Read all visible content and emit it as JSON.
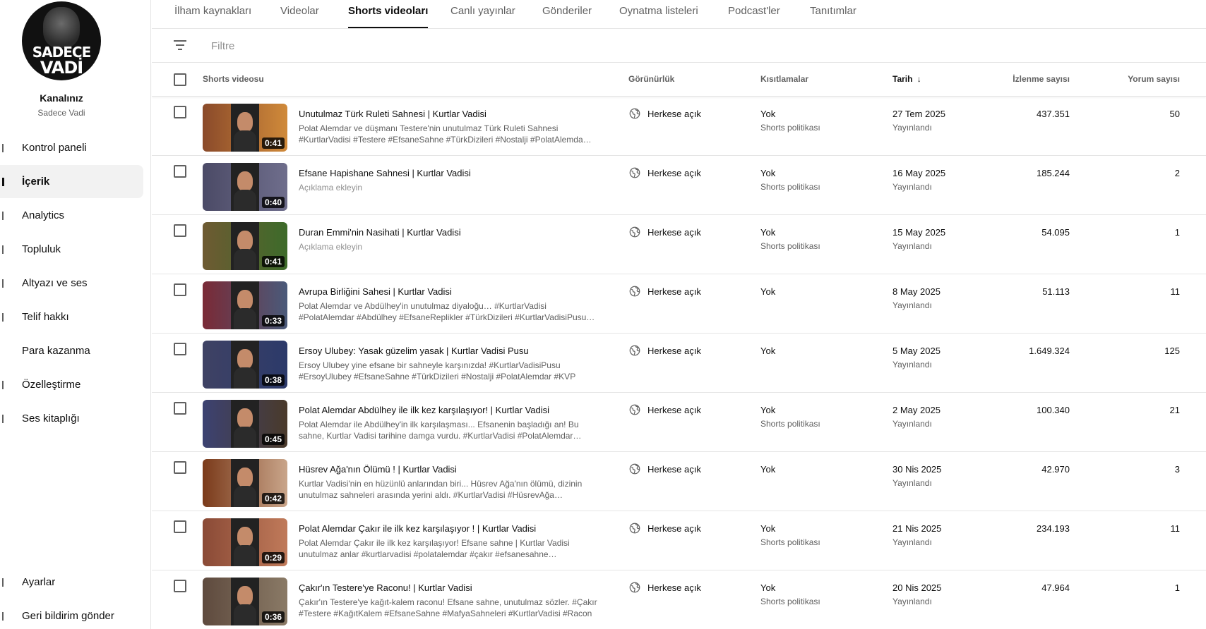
{
  "sidebar": {
    "avatar_text_top": "SADECE",
    "avatar_text_bottom": "VADİ",
    "channel_label": "Kanalınız",
    "channel_name": "Sadece Vadi",
    "items": [
      {
        "label": "Kontrol paneli",
        "icon": "dashboard-icon"
      },
      {
        "label": "İçerik",
        "icon": "content-icon",
        "active": true
      },
      {
        "label": "Analytics",
        "icon": "analytics-icon"
      },
      {
        "label": "Topluluk",
        "icon": "community-icon"
      },
      {
        "label": "Altyazı ve ses",
        "icon": "subtitles-icon"
      },
      {
        "label": "Telif hakkı",
        "icon": "copyright-icon"
      },
      {
        "label": "Para kazanma",
        "icon": "monetization-icon"
      },
      {
        "label": "Özelleştirme",
        "icon": "customization-icon"
      },
      {
        "label": "Ses kitaplığı",
        "icon": "audio-library-icon"
      }
    ],
    "bottom_items": [
      {
        "label": "Ayarlar",
        "icon": "settings-icon"
      },
      {
        "label": "Geri bildirim gönder",
        "icon": "feedback-icon"
      }
    ]
  },
  "tabs": [
    "İlham kaynakları",
    "Videolar",
    "Shorts videoları",
    "Canlı yayınlar",
    "Gönderiler",
    "Oynatma listeleri",
    "Podcast'ler",
    "Tanıtımlar"
  ],
  "active_tab": "Shorts videoları",
  "filter": {
    "placeholder": "Filtre",
    "icon": "filter-icon"
  },
  "columns": {
    "video": "Shorts videosu",
    "visibility": "Görünürlük",
    "restrictions": "Kısıtlamalar",
    "date": "Tarih",
    "date_sort": "↓",
    "views": "İzlenme sayısı",
    "comments": "Yorum sayısı"
  },
  "rows": [
    {
      "title": "Unutulmaz Türk Ruleti Sahnesi | Kurtlar Vadisi",
      "desc": "Polat Alemdar ve düşmanı Testere'nin unutulmaz Türk Ruleti Sahnesi #KurtlarVadisi #Testere #EfsaneSahne #TürkDizileri #Nostalji #PolatAlemda…",
      "desc_placeholder": false,
      "duration": "0:41",
      "visibility": "Herkese açık",
      "restriction": "Yok",
      "restriction_sub": "Shorts politikası",
      "date": "27 Tem 2025",
      "date_status": "Yayınlandı",
      "views": "437.351",
      "comments": "50",
      "thumb_bg": "#8a4a2a",
      "thumb_accent": "#d08a3a"
    },
    {
      "title": "Efsane Hapishane Sahnesi | Kurtlar Vadisi",
      "desc": "Açıklama ekleyin",
      "desc_placeholder": true,
      "duration": "0:40",
      "visibility": "Herkese açık",
      "restriction": "Yok",
      "restriction_sub": "Shorts politikası",
      "date": "16 May 2025",
      "date_status": "Yayınlandı",
      "views": "185.244",
      "comments": "2",
      "thumb_bg": "#4b4a66",
      "thumb_accent": "#6f6e8c"
    },
    {
      "title": "Duran Emmi'nin Nasihati | Kurtlar Vadisi",
      "desc": "Açıklama ekleyin",
      "desc_placeholder": true,
      "duration": "0:41",
      "visibility": "Herkese açık",
      "restriction": "Yok",
      "restriction_sub": "Shorts politikası",
      "date": "15 May 2025",
      "date_status": "Yayınlandı",
      "views": "54.095",
      "comments": "1",
      "thumb_bg": "#6e5a32",
      "thumb_accent": "#3d6b2a"
    },
    {
      "title": "Avrupa Birliğini Sahesi | Kurtlar Vadisi",
      "desc": "Polat Alemdar ve Abdülhey'in unutulmaz diyaloğu… #KurtlarVadisi #PolatAlemdar #Abdülhey #EfsaneReplikler #TürkDizileri #KurtlarVadisiPusu…",
      "desc_placeholder": false,
      "duration": "0:33",
      "visibility": "Herkese açık",
      "restriction": "Yok",
      "restriction_sub": "",
      "date": "8 May 2025",
      "date_status": "Yayınlandı",
      "views": "51.113",
      "comments": "11",
      "thumb_bg": "#7a2a36",
      "thumb_accent": "#4a5a7a"
    },
    {
      "title": "Ersoy Ulubey: Yasak güzelim yasak | Kurtlar Vadisi Pusu",
      "desc": "Ersoy Ulubey yine efsane bir sahneyle karşınızda! #KurtlarVadisiPusu #ErsoyUlubey #EfsaneSahne #TürkDizileri #Nostalji #PolatAlemdar #KVP",
      "desc_placeholder": false,
      "duration": "0:38",
      "visibility": "Herkese açık",
      "restriction": "Yok",
      "restriction_sub": "",
      "date": "5 May 2025",
      "date_status": "Yayınlandı",
      "views": "1.649.324",
      "comments": "125",
      "thumb_bg": "#3f4264",
      "thumb_accent": "#2c3a6a"
    },
    {
      "title": "Polat Alemdar Abdülhey ile ilk kez karşılaşıyor! | Kurtlar Vadisi",
      "desc": "Polat Alemdar ile Abdülhey'in ilk karşılaşması... Efsanenin başladığı an! Bu sahne, Kurtlar Vadisi tarihine damga vurdu. #KurtlarVadisi #PolatAlemdar…",
      "desc_placeholder": false,
      "duration": "0:45",
      "visibility": "Herkese açık",
      "restriction": "Yok",
      "restriction_sub": "Shorts politikası",
      "date": "2 May 2025",
      "date_status": "Yayınlandı",
      "views": "100.340",
      "comments": "21",
      "thumb_bg": "#3c4272",
      "thumb_accent": "#4a3a2a"
    },
    {
      "title": "Hüsrev Ağa'nın Ölümü ! | Kurtlar Vadisi",
      "desc": "Kurtlar Vadisi'nin en hüzünlü anlarından biri... Hüsrev Ağa'nın ölümü, dizinin unutulmaz sahneleri arasında yerini aldı. #KurtlarVadisi #HüsrevAğa…",
      "desc_placeholder": false,
      "duration": "0:42",
      "visibility": "Herkese açık",
      "restriction": "Yok",
      "restriction_sub": "",
      "date": "30 Nis 2025",
      "date_status": "Yayınlandı",
      "views": "42.970",
      "comments": "3",
      "thumb_bg": "#7a3a1a",
      "thumb_accent": "#c9a58a"
    },
    {
      "title": "Polat Alemdar Çakır ile ilk kez karşılaşıyor ! | Kurtlar Vadisi",
      "desc": "Polat Alemdar Çakır ile ilk kez karşılaşıyor! Efsane sahne | Kurtlar Vadisi unutulmaz anlar #kurtlarvadisi #polatalemdar #çakır #efsanesahne…",
      "desc_placeholder": false,
      "duration": "0:29",
      "visibility": "Herkese açık",
      "restriction": "Yok",
      "restriction_sub": "Shorts politikası",
      "date": "21 Nis 2025",
      "date_status": "Yayınlandı",
      "views": "234.193",
      "comments": "11",
      "thumb_bg": "#8a4a36",
      "thumb_accent": "#c07a5a"
    },
    {
      "title": "Çakır'ın Testere'ye Raconu! | Kurtlar Vadisi",
      "desc": "Çakır'ın Testere'ye kağıt-kalem raconu! Efsane sahne, unutulmaz sözler. #Çakır #Testere #KağıtKalem #EfsaneSahne #MafyaSahneleri #KurtlarVadisi #Racon",
      "desc_placeholder": false,
      "duration": "0:36",
      "visibility": "Herkese açık",
      "restriction": "Yok",
      "restriction_sub": "Shorts politikası",
      "date": "20 Nis 2025",
      "date_status": "Yayınlandı",
      "views": "47.964",
      "comments": "1",
      "thumb_bg": "#5e4a3e",
      "thumb_accent": "#8a7a66"
    }
  ]
}
